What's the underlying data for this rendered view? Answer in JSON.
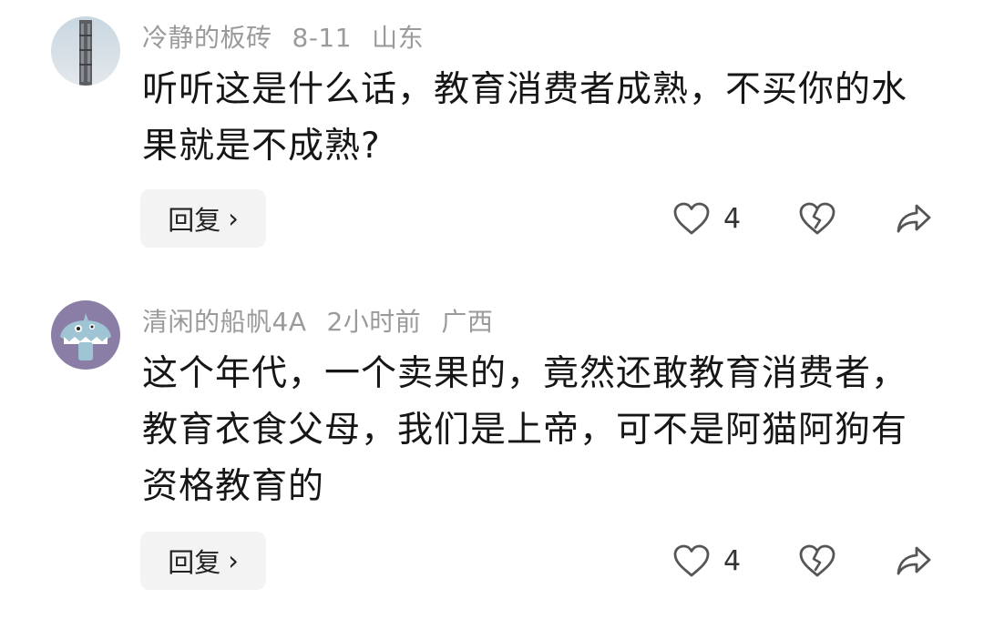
{
  "comments": [
    {
      "username": "冷静的板砖",
      "date": "8-11",
      "location": "山东",
      "text": "听听这是什么话，教育消费者成熟，不买你的水果就是不成熟?",
      "reply_label": "回复",
      "reply_chevron": "›",
      "like_count": "4",
      "avatar_icon": "avatar-building-photo"
    },
    {
      "username": "清闲的船帆4A",
      "date": "2小时前",
      "location": "广西",
      "text": "这个年代，一个卖果的，竟然还敢教育消费者，教育衣食父母，我们是上帝，可不是阿猫阿狗有资格教育的",
      "reply_label": "回复",
      "reply_chevron": "›",
      "like_count": "4",
      "avatar_icon": "avatar-blue-monster"
    }
  ],
  "icons": {
    "like": "heart-outline-icon",
    "dislike": "broken-heart-icon",
    "share": "share-arrow-icon"
  },
  "colors": {
    "meta_text": "#9a9a9a",
    "body_text": "#161616",
    "reply_bg": "#f3f3f3",
    "icon_stroke": "#555555"
  }
}
